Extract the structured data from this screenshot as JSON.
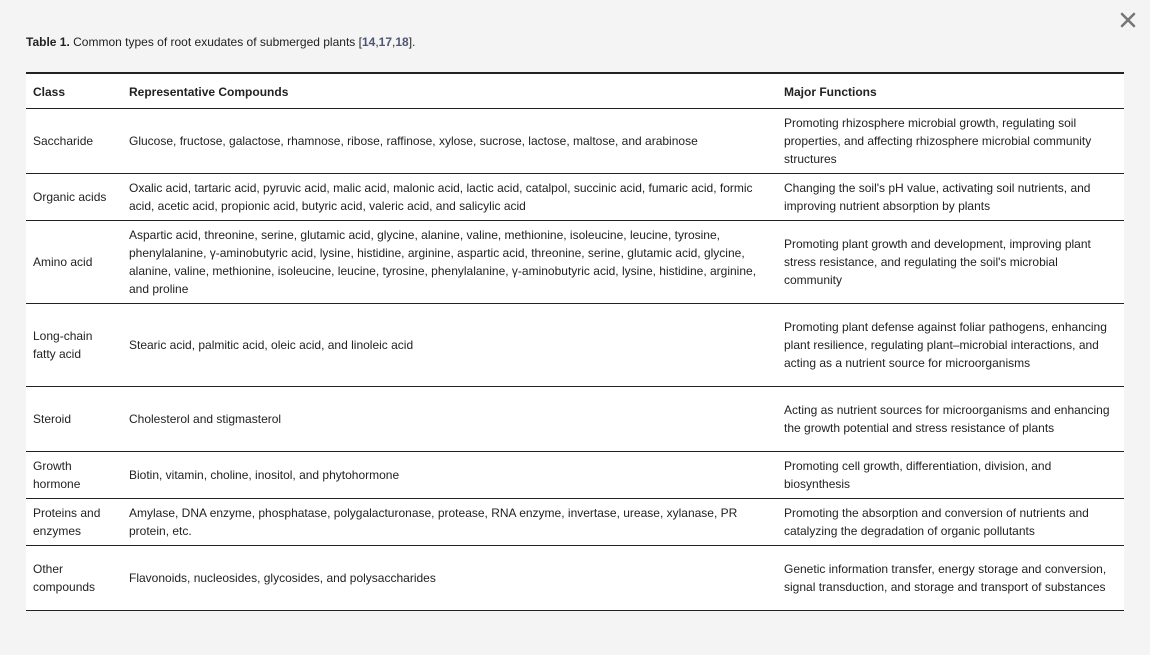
{
  "dialog": {
    "close_icon": "close-icon"
  },
  "caption": {
    "label": "Table 1.",
    "text": " Common types of root exudates of submerged plants [",
    "citations": [
      "14",
      "17",
      "18"
    ],
    "separator": ",",
    "suffix": "]."
  },
  "colors": {
    "background": "#f4f4f4",
    "table_background": "#ffffff",
    "rule": "#222222",
    "citation_link": "#4f5671"
  },
  "table": {
    "headers": [
      "Class",
      "Representative Compounds",
      "Major Functions"
    ],
    "rows": [
      {
        "class": "Saccharide",
        "compounds": "Glucose, fructose, galactose, rhamnose, ribose, raffinose, xylose, sucrose, lactose, maltose, and arabinose",
        "functions": "Promoting rhizosphere microbial growth, regulating soil properties, and affecting rhizosphere microbial community structures"
      },
      {
        "class": "Organic acids",
        "compounds": "Oxalic acid, tartaric acid, pyruvic acid, malic acid, malonic acid, lactic acid, catalpol, succinic acid, fumaric acid, formic acid, acetic acid, propionic acid, butyric acid, valeric acid, and salicylic acid",
        "functions": "Changing the soil's pH value, activating soil nutrients, and improving nutrient absorption by plants"
      },
      {
        "class": "Amino acid",
        "compounds": "Aspartic acid, threonine, serine, glutamic acid, glycine, alanine, valine, methionine, isoleucine, leucine, tyrosine, phenylalanine, γ-aminobutyric acid, lysine, histidine, arginine, aspartic acid, threonine, serine, glutamic acid, glycine, alanine, valine, methionine, isoleucine, leucine, tyrosine, phenylalanine, γ-aminobutyric acid, lysine, histidine, arginine, and proline",
        "functions": "Promoting plant growth and development, improving plant stress resistance, and regulating the soil's microbial community"
      },
      {
        "class": "Long-chain fatty acid",
        "compounds": "Stearic acid, palmitic acid, oleic acid, and linoleic acid",
        "functions": "Promoting plant defense against foliar pathogens, enhancing plant resilience, regulating plant–microbial interactions, and acting as a nutrient source for microorganisms"
      },
      {
        "class": "Steroid",
        "compounds": "Cholesterol and stigmasterol",
        "functions": "Acting as nutrient sources for microorganisms and enhancing the growth potential and stress resistance of plants"
      },
      {
        "class": "Growth hormone",
        "compounds": "Biotin, vitamin, choline, inositol, and phytohormone",
        "functions": "Promoting cell growth, differentiation, division, and biosynthesis"
      },
      {
        "class": "Proteins and enzymes",
        "compounds": "Amylase, DNA enzyme, phosphatase, polygalacturonase, protease, RNA enzyme, invertase, urease, xylanase, PR protein, etc.",
        "functions": "Promoting the absorption and conversion of nutrients and catalyzing the degradation of organic pollutants"
      },
      {
        "class": "Other compounds",
        "compounds": "Flavonoids, nucleosides, glycosides, and polysaccharides",
        "functions": "Genetic information transfer, energy storage and conversion, signal transduction, and storage and transport of substances"
      }
    ]
  }
}
